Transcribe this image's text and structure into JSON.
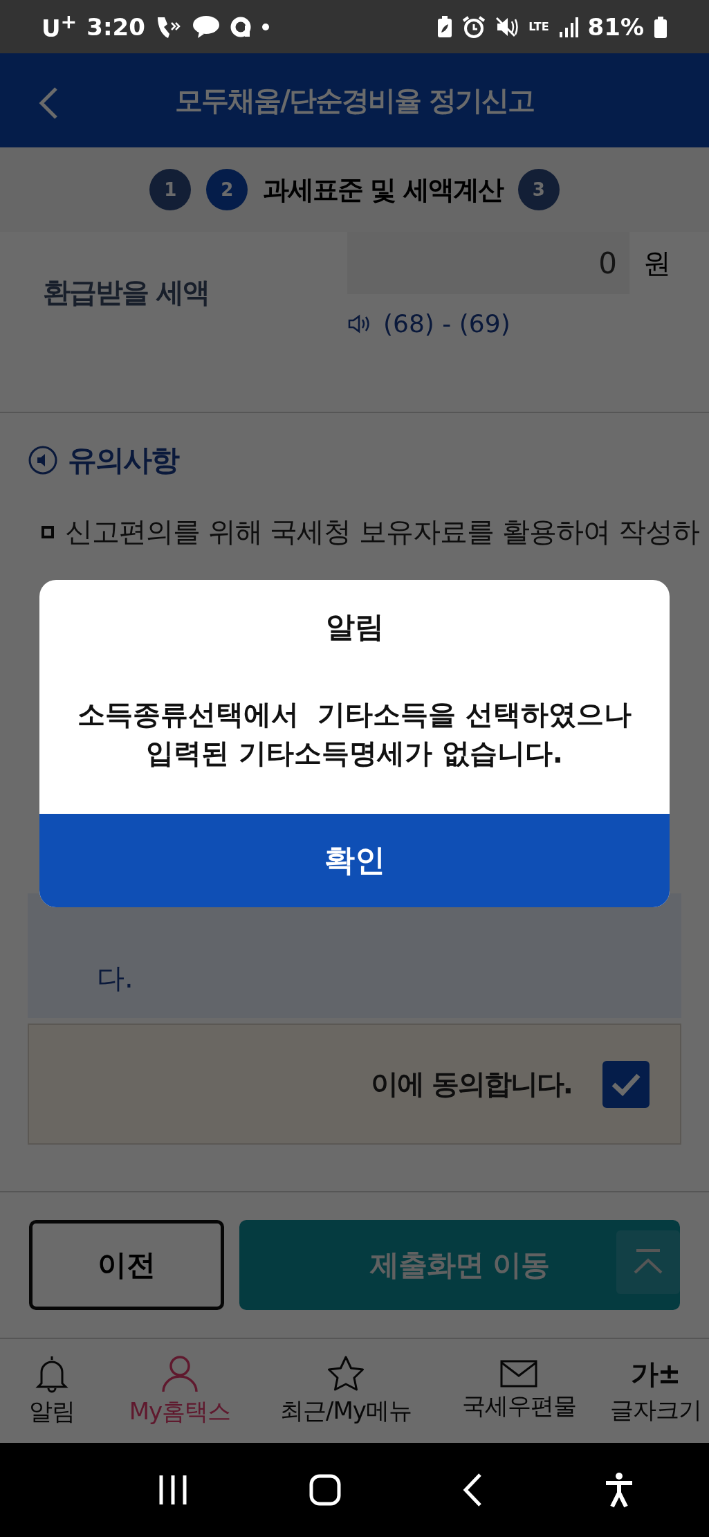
{
  "status_bar": {
    "carrier": "U$^{+}$",
    "time": "3:20",
    "network": "LTE",
    "battery": "81%"
  },
  "header": {
    "title": "모두채움/단순경비율 정기신고"
  },
  "steps": [
    {
      "number": "1",
      "selected": false
    },
    {
      "number": "2",
      "label": "과세표준 및 세액계산",
      "selected": true
    },
    {
      "number": "3",
      "selected": false
    }
  ],
  "amount_row": {
    "label": "환급받을 세액",
    "value": "0",
    "unit": "원",
    "formula": "(68) - (69)"
  },
  "notice": {
    "title": "유의사항",
    "first_line": "신고편의를 위해 국세청 보유자료를 활용하여 작성하",
    "blue_tail": "다."
  },
  "agree": {
    "label": "이에 동의합니다.",
    "checked": true
  },
  "buttons": {
    "previous": "이전",
    "submit": "제출화면 이동"
  },
  "bottom_nav": [
    {
      "kind": "bell",
      "label": "알림",
      "selected": false
    },
    {
      "kind": "person",
      "label": "My홈택스",
      "selected": true
    },
    {
      "kind": "star",
      "label": "최근/My메뉴",
      "selected": false
    },
    {
      "kind": "mail",
      "label": "국세우편물",
      "selected": false
    },
    {
      "kind": "glyph",
      "glyph": "가±",
      "label": "글자크기",
      "selected": false
    }
  ],
  "dialog": {
    "title": "알림",
    "message_lines": [
      "소득종류선택에서  기타소득을 선택하였으나",
      "입력된 기타소득명세가 없습니다."
    ],
    "confirm": "확인"
  }
}
